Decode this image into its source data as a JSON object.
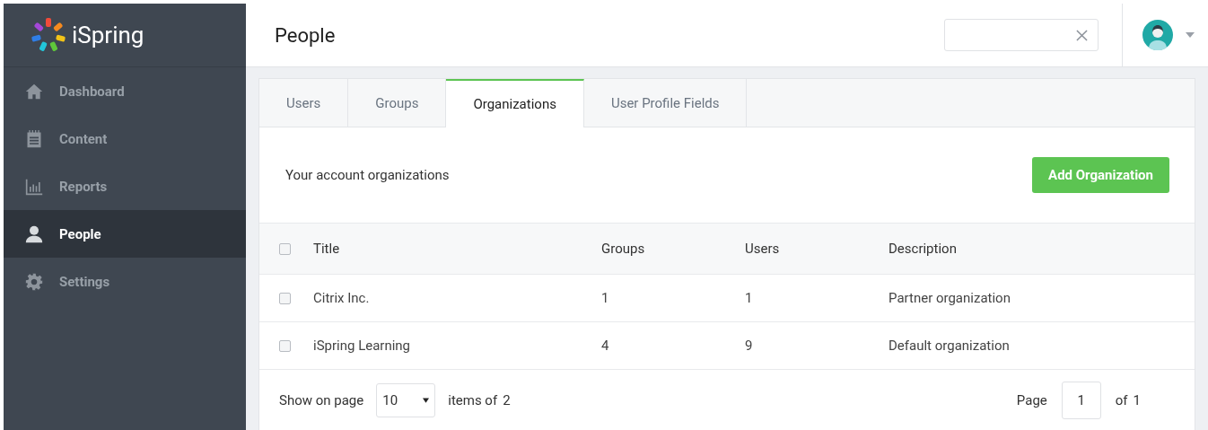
{
  "logo": {
    "text": "iSpring"
  },
  "sidebar": {
    "items": [
      {
        "label": "Dashboard",
        "selected": false
      },
      {
        "label": "Content",
        "selected": false
      },
      {
        "label": "Reports",
        "selected": false
      },
      {
        "label": "People",
        "selected": true
      },
      {
        "label": "Settings",
        "selected": false
      }
    ]
  },
  "header": {
    "title": "People"
  },
  "tabs": [
    {
      "label": "Users",
      "selected": false
    },
    {
      "label": "Groups",
      "selected": false
    },
    {
      "label": "Organizations",
      "selected": true
    },
    {
      "label": "User Profile Fields",
      "selected": false
    }
  ],
  "panel": {
    "caption": "Your account organizations",
    "add_button": "Add Organization"
  },
  "table": {
    "header_checked": false,
    "columns": [
      "Title",
      "Groups",
      "Users",
      "Description"
    ],
    "rows": [
      {
        "checked": false,
        "cells": [
          "Citrix Inc.",
          "1",
          "1",
          "Partner organization"
        ]
      },
      {
        "checked": false,
        "cells": [
          "iSpring Learning",
          "4",
          "9",
          "Default organization"
        ]
      }
    ]
  },
  "footer": {
    "show_label": "Show on page",
    "page_size": "10",
    "items_of": "items of",
    "total": "2",
    "page_label": "Page",
    "page": "1",
    "of_label": "of",
    "pages": "1"
  }
}
